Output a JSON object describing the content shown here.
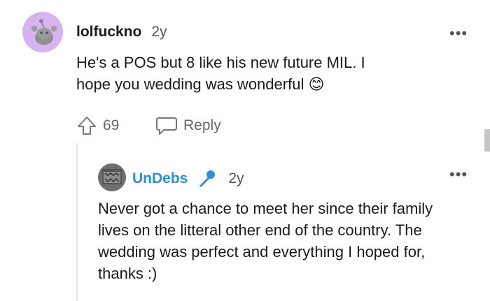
{
  "comment": {
    "username": "lolfuckno",
    "age": "2y",
    "body": "He's a POS but 8 like his new future MIL. I hope you wedding was wonderful",
    "emoji": "😊",
    "upvotes": "69",
    "reply_label": "Reply",
    "more_label": "•••"
  },
  "reply": {
    "username": "UnDebs",
    "age": "2y",
    "body": "Never got a chance to meet her since their family lives on the litteral other end of the country. The wedding was perfect and everything I hoped for, thanks :)",
    "more_label": "•••"
  }
}
